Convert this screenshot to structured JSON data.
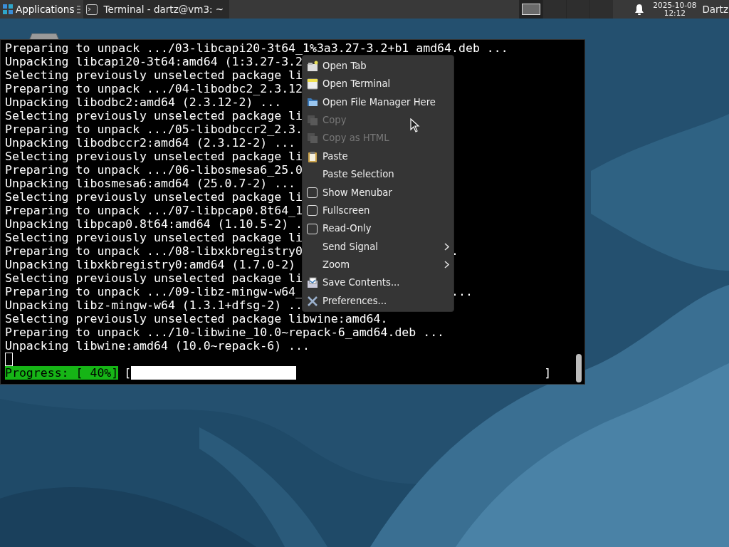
{
  "panel": {
    "apps_menu": {
      "label": "Applications"
    },
    "tasks": [
      {
        "title": "Terminal - dartz@vm3: ~",
        "selected": true
      }
    ],
    "workspaces": [
      {
        "selected": true
      },
      {
        "selected": false
      },
      {
        "selected": false
      },
      {
        "selected": false
      }
    ],
    "clock": {
      "date": "2025-10-08",
      "time": "12:12"
    },
    "user": "Dartz"
  },
  "terminal": {
    "lines": [
      {
        "text": "Preparing to unpack .../03-libcapi20-3t64_1%3a3.27-3.2+b1 amd64.deb ..."
      },
      {
        "text": "Unpacking libcapi20-3t64:amd64 (1:3.27-3.2"
      },
      {
        "text": "Selecting previously unselected package li"
      },
      {
        "text": "Preparing to unpack .../04-libodbc2_2.3.12"
      },
      {
        "text": "Unpacking libodbc2:amd64 (2.3.12-2) ..."
      },
      {
        "text": "Selecting previously unselected package li"
      },
      {
        "text": "Preparing to unpack .../05-libodbccr2_2.3."
      },
      {
        "text": "Unpacking libodbccr2:amd64 (2.3.12-2) ..."
      },
      {
        "text": "Selecting previously unselected package li"
      },
      {
        "text": "Preparing to unpack .../06-libosmesa6_25.0"
      },
      {
        "text": "Unpacking libosmesa6:amd64 (25.0.7-2) ..."
      },
      {
        "text": "Selecting previously unselected package li"
      },
      {
        "text": "Preparing to unpack .../07-libpcap0.8t64_1"
      },
      {
        "text": "Unpacking libpcap0.8t64:amd64 (1.10.5-2) ."
      },
      {
        "text": "Selecting previously unselected package li"
      },
      {
        "text": "Preparing to unpack .../08-libxkbregistry0",
        "tail": "."
      },
      {
        "text": "Unpacking libxkbregistry0:amd64 (1.7.0-2)"
      },
      {
        "text": "Selecting previously unselected package li"
      },
      {
        "text": "Preparing to unpack .../09-libz-mingw-w64_",
        "tail": "..."
      },
      {
        "text": "Unpacking libz-mingw-w64 (1.3.1+dfsg-2) .."
      },
      {
        "text": "Selecting previously unselected package libwine:amd64."
      },
      {
        "text": "Preparing to unpack .../10-libwine_10.0~repack-6_amd64.deb ..."
      },
      {
        "text": "Unpacking libwine:amd64 (10.0~repack-6) ..."
      }
    ],
    "progress": {
      "label": "Progress: [ 40%]",
      "open": "[",
      "close": "]",
      "level": 0.4
    }
  },
  "context_menu": {
    "items": [
      {
        "label": "Open Tab",
        "kind": "action",
        "disabled": false
      },
      {
        "label": "Open Terminal",
        "kind": "action",
        "disabled": false
      },
      {
        "label": "Open File Manager Here",
        "kind": "action",
        "disabled": false
      },
      {
        "label": "Copy",
        "kind": "action",
        "disabled": true
      },
      {
        "label": "Copy as HTML",
        "kind": "action",
        "disabled": true
      },
      {
        "label": "Paste",
        "kind": "action",
        "disabled": false
      },
      {
        "label": "Paste Selection",
        "kind": "plain",
        "disabled": false
      },
      {
        "label": "Show Menubar",
        "kind": "check",
        "checked": false,
        "disabled": false
      },
      {
        "label": "Fullscreen",
        "kind": "check",
        "checked": false,
        "disabled": false
      },
      {
        "label": "Read-Only",
        "kind": "check",
        "checked": false,
        "disabled": false
      },
      {
        "label": "Send Signal",
        "kind": "submenu",
        "disabled": false
      },
      {
        "label": "Zoom",
        "kind": "submenu",
        "disabled": false
      },
      {
        "label": "Save Contents...",
        "kind": "action",
        "disabled": false
      },
      {
        "label": "Preferences...",
        "kind": "action",
        "disabled": false
      }
    ]
  }
}
